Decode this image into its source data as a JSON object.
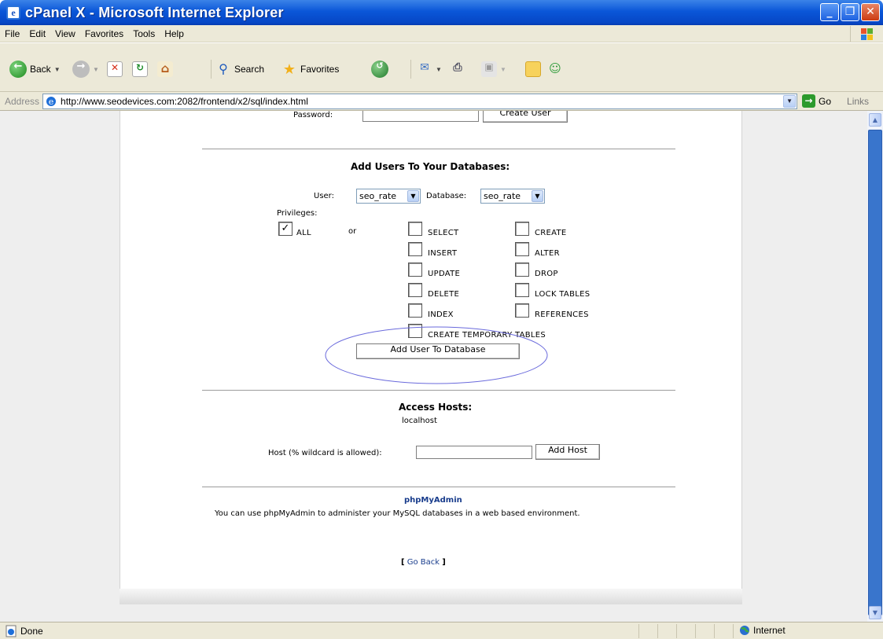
{
  "window": {
    "title": "cPanel X - Microsoft Internet Explorer",
    "minimize": "_",
    "maximize": "❐",
    "close": "✕"
  },
  "menu": [
    "File",
    "Edit",
    "View",
    "Favorites",
    "Tools",
    "Help"
  ],
  "toolbar": {
    "back": "Back",
    "search": "Search",
    "favorites": "Favorites"
  },
  "address": {
    "label": "Address",
    "url": "http://www.seodevices.com:2082/frontend/x2/sql/index.html",
    "go": "Go",
    "links": "Links"
  },
  "create_user": {
    "password_label": "Password:",
    "password_value": "",
    "button": "Create User"
  },
  "add_users": {
    "heading": "Add Users To Your Databases:",
    "user_label": "User:",
    "user_value": "seo_rate",
    "database_label": "Database:",
    "database_value": "seo_rate",
    "privileges_label": "Privileges:",
    "all_label": "ALL",
    "all_checked": true,
    "or_label": "or",
    "privileges": [
      {
        "label": "SELECT",
        "checked": false
      },
      {
        "label": "CREATE",
        "checked": false
      },
      {
        "label": "INSERT",
        "checked": false
      },
      {
        "label": "ALTER",
        "checked": false
      },
      {
        "label": "UPDATE",
        "checked": false
      },
      {
        "label": "DROP",
        "checked": false
      },
      {
        "label": "DELETE",
        "checked": false
      },
      {
        "label": "LOCK TABLES",
        "checked": false
      },
      {
        "label": "INDEX",
        "checked": false
      },
      {
        "label": "REFERENCES",
        "checked": false
      },
      {
        "label": "CREATE TEMPORARY TABLES",
        "checked": false
      }
    ],
    "button": "Add User To Database"
  },
  "access_hosts": {
    "heading": "Access Hosts:",
    "hosts": [
      "localhost"
    ],
    "host_label": "Host (% wildcard is allowed):",
    "host_value": "",
    "button": "Add Host"
  },
  "phpmyadmin": {
    "link": "phpMyAdmin",
    "description": "You can use phpMyAdmin to administer your MySQL databases in a web based environment."
  },
  "go_back": {
    "open": "[",
    "label": "Go Back",
    "close": "]"
  },
  "status": {
    "text": "Done",
    "zone": "Internet"
  },
  "colors": {
    "titlebar": "#0a56d8",
    "link": "#183c8c",
    "annotation_ellipse": "#6a6adc",
    "chrome": "#ece9d8"
  },
  "icons": {
    "title": "ie-icon",
    "back": "back-arrow-icon",
    "forward": "forward-arrow-icon",
    "stop": "stop-icon",
    "refresh": "refresh-icon",
    "home": "home-icon",
    "search": "search-icon",
    "favorites": "star-icon",
    "media": "media-icon",
    "mail": "mail-icon",
    "print": "printer-icon",
    "edit": "edit-icon",
    "folder": "folder-icon",
    "messenger": "messenger-icon",
    "go": "go-arrow-icon",
    "done": "page-icon",
    "internet": "globe-icon"
  }
}
